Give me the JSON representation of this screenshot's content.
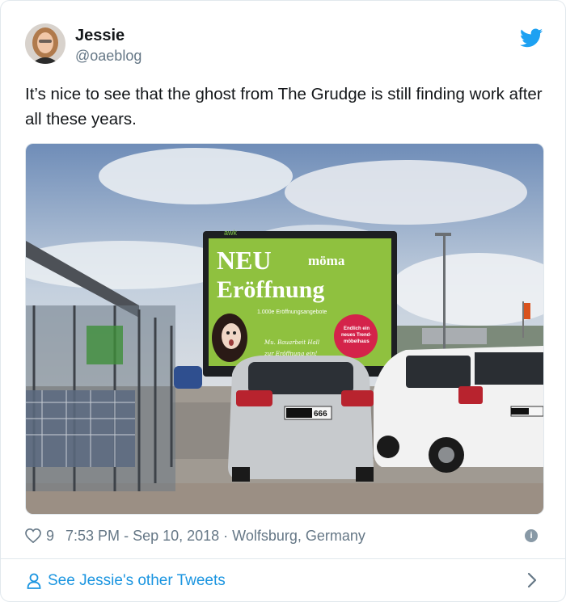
{
  "author": {
    "name": "Jessie",
    "handle": "@oaeblog"
  },
  "tweet": {
    "text": "It’s nice to see that the ghost from The Grudge is still finding work after all these years."
  },
  "photo": {
    "billboard": {
      "brand": "awk",
      "headline_1": "NEU",
      "headline_2": "Eröffnung",
      "store": "möma",
      "subline": "1.000e Eröffnungsangebote",
      "handwriting_1": "Mu. Bauarbeit Hall",
      "handwriting_2": "zur Eröffnung ein!",
      "badge_1": "Endlich ein",
      "badge_2": "neues Trend-",
      "badge_3": "möbelhaus"
    },
    "plate": "666"
  },
  "meta": {
    "likes": "9",
    "time": "7:53 PM",
    "date_sep": "-",
    "date": "Sep 10, 2018",
    "dot": "·",
    "location": "Wolfsburg, Germany"
  },
  "footer": {
    "link_label": "See Jessie's other Tweets"
  },
  "colors": {
    "link_blue": "#1b95e0",
    "twitter_blue": "#1da1f2",
    "muted": "#657786"
  },
  "icons": [
    "twitter-bird-icon",
    "heart-icon",
    "info-icon",
    "user-icon",
    "chevron-right-icon"
  ]
}
